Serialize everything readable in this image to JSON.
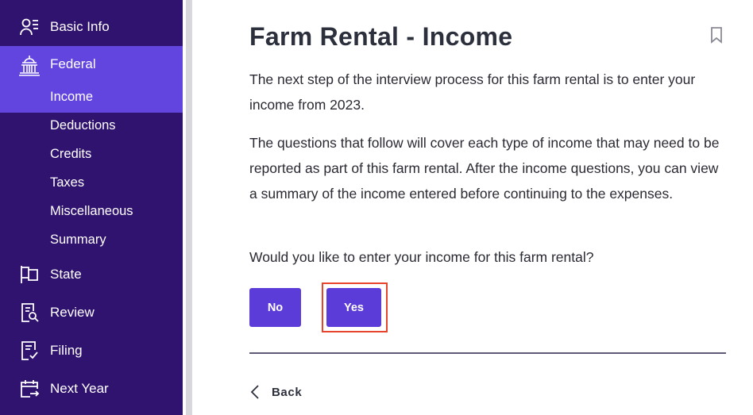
{
  "sidebar": {
    "items": [
      {
        "label": "Basic Info",
        "icon": "user-list-icon"
      },
      {
        "label": "Federal",
        "icon": "capitol-building-icon"
      },
      {
        "label": "State",
        "icon": "flag-icon"
      },
      {
        "label": "Review",
        "icon": "document-search-icon"
      },
      {
        "label": "Filing",
        "icon": "document-check-icon"
      },
      {
        "label": "Next Year",
        "icon": "calendar-arrow-icon"
      }
    ],
    "federal_subitems": [
      {
        "label": "Income"
      },
      {
        "label": "Deductions"
      },
      {
        "label": "Credits"
      },
      {
        "label": "Taxes"
      },
      {
        "label": "Miscellaneous"
      },
      {
        "label": "Summary"
      }
    ]
  },
  "main": {
    "title": "Farm Rental - Income",
    "paragraph1": "The next step of the interview process for this farm rental is to enter your income from 2023.",
    "paragraph2": "The questions that follow will cover each type of income that may need to be reported as part of this farm rental. After the income questions, you can view a summary of the income entered before continuing to the expenses.",
    "question": "Would you like to enter your income for this farm rental?",
    "no_label": "No",
    "yes_label": "Yes",
    "back_label": "Back"
  },
  "colors": {
    "sidebar_bg": "#30136e",
    "sidebar_active": "#6244df",
    "button": "#5c3cd9",
    "highlight": "#e8442c"
  }
}
